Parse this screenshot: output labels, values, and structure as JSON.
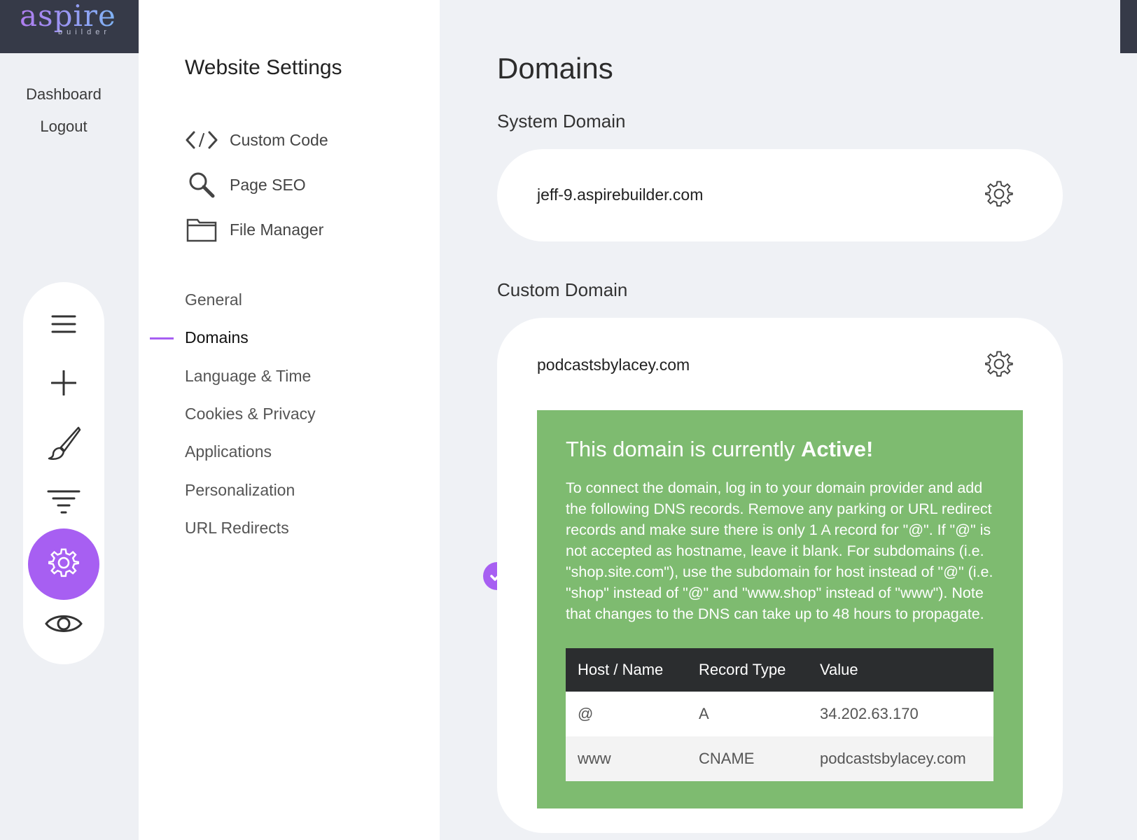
{
  "brand": {
    "name": "aspire",
    "sub": "builder"
  },
  "rail": {
    "links": [
      "Dashboard",
      "Logout"
    ],
    "tools": [
      "menu-icon",
      "plus-icon",
      "brush-icon",
      "filter-icon",
      "gear-icon",
      "eye-icon"
    ],
    "active_tool": "gear-icon",
    "accent": "#a75ff2"
  },
  "settings": {
    "title": "Website Settings",
    "tools": [
      {
        "label": "Custom Code",
        "icon": "code-icon"
      },
      {
        "label": "Page SEO",
        "icon": "search-icon"
      },
      {
        "label": "File Manager",
        "icon": "folder-icon"
      }
    ],
    "nav": [
      "General",
      "Domains",
      "Language & Time",
      "Cookies & Privacy",
      "Applications",
      "Personalization",
      "URL Redirects"
    ],
    "active_nav": "Domains"
  },
  "main": {
    "title": "Domains",
    "system_domain": {
      "heading": "System Domain",
      "value": "jeff-9.aspirebuilder.com"
    },
    "custom_domain": {
      "heading": "Custom Domain",
      "value": "podcastsbylacey.com",
      "status_prefix": "This domain is currently ",
      "status_strong": "Active!",
      "status_color": "#7ebb70",
      "instructions": "To connect the domain, log in to your domain provider and add the following DNS records. Remove any parking or URL redirect records and make sure there is only 1 A record for \"@\". If \"@\" is not accepted as hostname, leave it blank. For subdomains (i.e. \"shop.site.com\"), use the subdomain for host instead of \"@\" (i.e. \"shop\" instead of \"@\" and \"www.shop\" instead of \"www\"). Note that changes to the DNS can take up to 48 hours to propagate.",
      "dns_headers": [
        "Host / Name",
        "Record Type",
        "Value"
      ],
      "dns_rows": [
        [
          "@",
          "A",
          "34.202.63.170"
        ],
        [
          "www",
          "CNAME",
          "podcastsbylacey.com"
        ]
      ]
    }
  }
}
